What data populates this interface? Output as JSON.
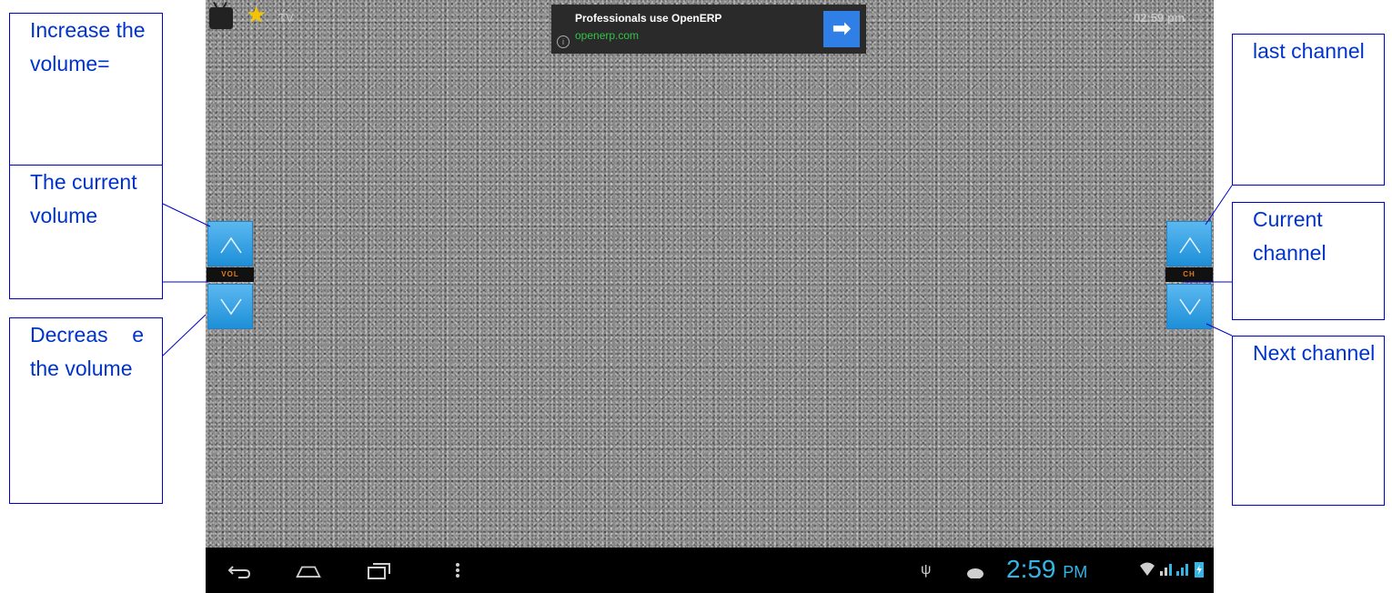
{
  "app": {
    "title": "TV",
    "clock": "02:59 pm"
  },
  "ad": {
    "title": "Professionals use OpenERP",
    "url": "openerp.com",
    "info": "i",
    "go_arrow": "➡"
  },
  "volume": {
    "label": "VOL",
    "up_icon": "chevron-up-icon",
    "down_icon": "chevron-down-icon"
  },
  "channel": {
    "label": "CH",
    "up_icon": "chevron-up-icon",
    "down_icon": "chevron-down-icon"
  },
  "system_bar": {
    "time": "2:59",
    "ampm": "PM",
    "icons": [
      "back-icon",
      "home-icon",
      "recent-apps-icon",
      "menu-icon",
      "usb-icon",
      "android-debug-icon",
      "wifi-icon",
      "signal-icon",
      "battery-icon"
    ]
  },
  "callouts": {
    "increase_volume": "Increase the volume=",
    "current_volume": "The current volume",
    "decrease_volume": "Decreas e the volume",
    "last_channel": "last channel",
    "current_channel": "Current channel",
    "next_channel": "Next channel"
  },
  "colors": {
    "accent": "#33b5e5",
    "button": "#1d8fd8",
    "callout_text": "#0033cc",
    "label_orange": "#e07b1f"
  }
}
